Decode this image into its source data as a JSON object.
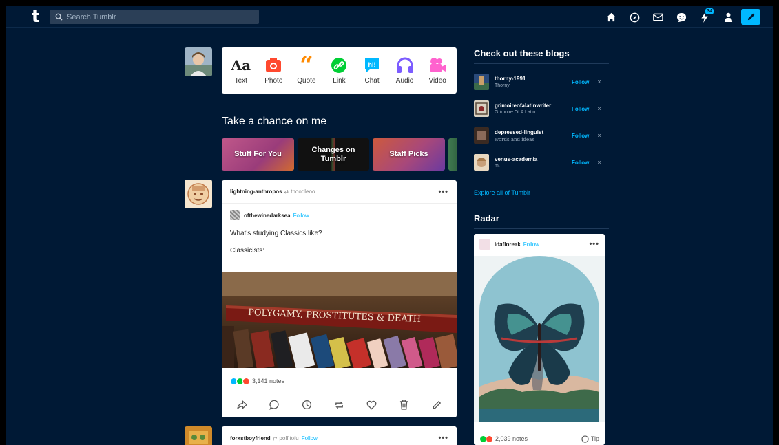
{
  "topbar": {
    "logo": "t",
    "search_placeholder": "Search Tumblr",
    "messages_badge": "34"
  },
  "post_types": [
    {
      "label": "Text",
      "icon": "text-icon",
      "color": "#222222"
    },
    {
      "label": "Photo",
      "icon": "camera-icon",
      "color": "#ff492f"
    },
    {
      "label": "Quote",
      "icon": "quote-icon",
      "color": "#ff8a00"
    },
    {
      "label": "Link",
      "icon": "link-icon",
      "color": "#00cf35"
    },
    {
      "label": "Chat",
      "icon": "chat-icon",
      "color": "#00b8ff"
    },
    {
      "label": "Audio",
      "icon": "headphones-icon",
      "color": "#7c5cff"
    },
    {
      "label": "Video",
      "icon": "video-camera-icon",
      "color": "#ff62ce"
    }
  ],
  "chance_section": {
    "title": "Take a chance on me",
    "items": [
      "Stuff For You",
      "Changes on Tumblr",
      "Staff Picks"
    ]
  },
  "post1": {
    "author": "lightning-anthropos",
    "via": "thoodleoo",
    "reblog_author": "ofthewinedarksea",
    "follow_label": "Follow",
    "text1": "What's studying Classics like?",
    "text2": "Classicists:",
    "book_title": "POLYGAMY, PROSTITUTES & DEATH",
    "notes": "3,141 notes"
  },
  "post2": {
    "author": "forxstboyfriend",
    "via": "poffitofu",
    "follow_label": "Follow"
  },
  "sidebar": {
    "blogs_title": "Check out these blogs",
    "blogs": [
      {
        "name": "thorny-1991",
        "sub": "Thorny"
      },
      {
        "name": "grimoireofalatinwriter",
        "sub": "Grimoire Of A Latin..."
      },
      {
        "name": "depressed-linguist",
        "sub": "words and ideas"
      },
      {
        "name": "venus-academia",
        "sub": "m."
      }
    ],
    "follow_label": "Follow",
    "dismiss_label": "×",
    "explore": "Explore all of Tumblr",
    "radar_title": "Radar",
    "radar_author": "idafloreak",
    "radar_notes": "2,039 notes",
    "tip_label": "Tip"
  },
  "colors": {
    "background": "#001935",
    "accent": "#00b8ff"
  }
}
